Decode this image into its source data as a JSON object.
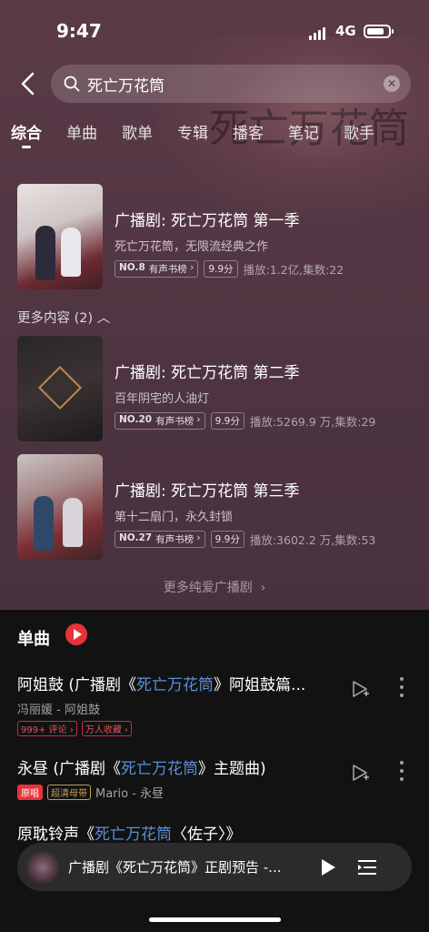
{
  "status": {
    "time": "9:47",
    "network": "4G"
  },
  "search": {
    "query": "死亡万花筒"
  },
  "tabs": [
    "综合",
    "单曲",
    "歌单",
    "专辑",
    "播客",
    "笔记",
    "歌手"
  ],
  "hero_art_text": "死亡万花筒",
  "albums": [
    {
      "title": "广播剧: 死亡万花筒 第一季",
      "subtitle": "死亡万花筒，无限流经典之作",
      "rank": "NO.8",
      "chart": "有声书榜",
      "score": "9.9分",
      "stats": "播放:1.2亿,集数:22"
    },
    {
      "title": "广播剧: 死亡万花筒 第二季",
      "subtitle": "百年阴宅的人油灯",
      "rank": "NO.20",
      "chart": "有声书榜",
      "score": "9.9分",
      "stats": "播放:5269.9 万,集数:29"
    },
    {
      "title": "广播剧: 死亡万花筒 第三季",
      "subtitle": "第十二扇门，永久封锁",
      "rank": "NO.27",
      "chart": "有声书榜",
      "score": "9.9分",
      "stats": "播放:3602.2 万,集数:53"
    }
  ],
  "more_content": "更多内容 (2)",
  "more_link": "更多纯爱广播剧",
  "songs_section": {
    "title": "单曲"
  },
  "songs": [
    {
      "pre": "阿姐鼓 (广播剧《",
      "hl": "死亡万花筒",
      "post": "》阿姐鼓篇...",
      "artist": "冯丽媛 - 阿姐鼓",
      "tags": [
        "999+ 评论",
        "万人收藏"
      ]
    },
    {
      "pre": "永昼 (广播剧《",
      "hl": "死亡万花筒",
      "post": "》主题曲)",
      "artist": "Mario - 永昼",
      "tags": [
        "原唱",
        "超清母带"
      ]
    },
    {
      "pre": "原耽铃声《",
      "hl": "死亡万花筒",
      "post": "〈佐子〉》",
      "artist": "",
      "tags": []
    }
  ],
  "player": {
    "title": "广播剧《死亡万花筒》正剧预告 -..."
  }
}
